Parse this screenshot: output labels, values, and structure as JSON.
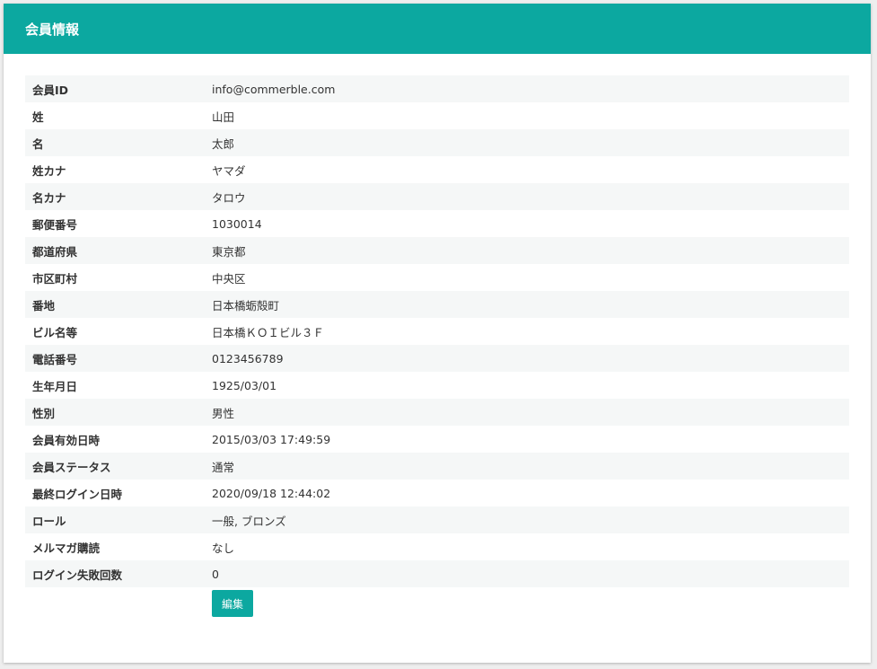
{
  "header": {
    "title": "会員情報"
  },
  "fields": [
    {
      "label": "会員ID",
      "value": "info@commerble.com"
    },
    {
      "label": "姓",
      "value": "山田"
    },
    {
      "label": "名",
      "value": "太郎"
    },
    {
      "label": "姓カナ",
      "value": "ヤマダ"
    },
    {
      "label": "名カナ",
      "value": "タロウ"
    },
    {
      "label": "郵便番号",
      "value": "1030014"
    },
    {
      "label": "都道府県",
      "value": "東京都"
    },
    {
      "label": "市区町村",
      "value": "中央区"
    },
    {
      "label": "番地",
      "value": "日本橋蛎殻町"
    },
    {
      "label": "ビル名等",
      "value": "日本橋ＫＯＩビル３Ｆ"
    },
    {
      "label": "電話番号",
      "value": "0123456789"
    },
    {
      "label": "生年月日",
      "value": "1925/03/01"
    },
    {
      "label": "性別",
      "value": "男性"
    },
    {
      "label": "会員有効日時",
      "value": "2015/03/03 17:49:59"
    },
    {
      "label": "会員ステータス",
      "value": "通常"
    },
    {
      "label": "最終ログイン日時",
      "value": "2020/09/18 12:44:02"
    },
    {
      "label": "ロール",
      "value": "一般, ブロンズ"
    },
    {
      "label": "メルマガ購読",
      "value": "なし"
    },
    {
      "label": "ログイン失敗回数",
      "value": "0"
    }
  ],
  "actions": {
    "edit_label": "編集"
  },
  "colors": {
    "accent": "#0ca8a0",
    "row_stripe": "#f5f7f7"
  }
}
